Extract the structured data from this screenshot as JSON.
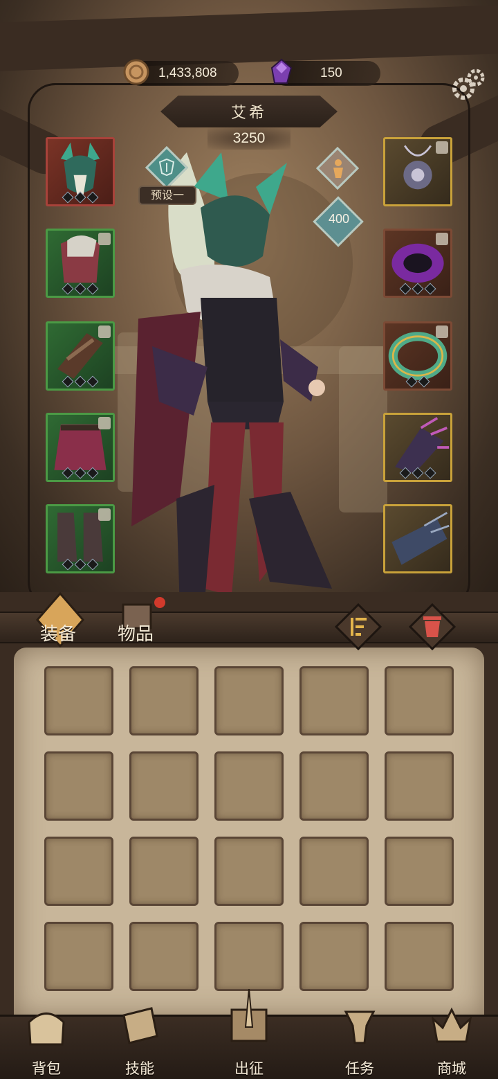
{
  "currency": {
    "coins": "1,433,808",
    "gems": "150"
  },
  "hero": {
    "name": "艾希",
    "power": "3250",
    "preset_label": "预设一",
    "points": "400"
  },
  "tabs": {
    "equip": "装备",
    "items": "物品"
  },
  "nav": [
    {
      "label": "背包"
    },
    {
      "label": "技能"
    },
    {
      "label": "出征"
    },
    {
      "label": "任务"
    },
    {
      "label": "商城"
    }
  ],
  "colors": {
    "accent_teal": "#5d8f91",
    "notify_red": "#d23a2c",
    "paper": "#c8b69a"
  },
  "icons": {
    "coin": "coin-icon",
    "gem": "purple-gem-icon",
    "settings": "gear-icon",
    "sort": "sort-icon",
    "trash": "trash-icon",
    "lock": "lock-icon"
  }
}
